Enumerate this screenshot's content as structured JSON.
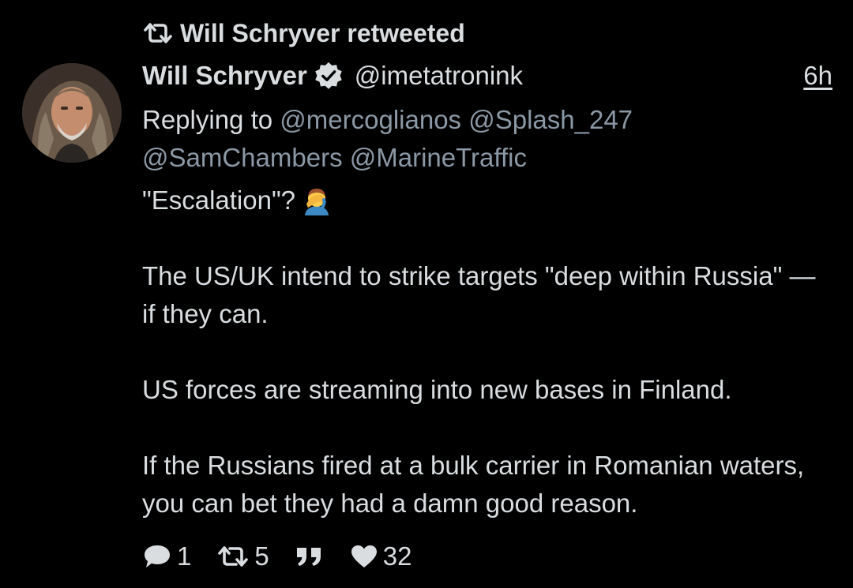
{
  "retweet_banner": {
    "icon": "retweet-icon",
    "text": "Will Schryver retweeted"
  },
  "author": {
    "display_name": "Will Schryver",
    "verified_icon": "verified-badge-icon",
    "handle": "@imetatronink",
    "avatar": "profile-avatar"
  },
  "time": "6h",
  "replying": {
    "prefix": "Replying to",
    "mentions": [
      "@mercoglianos",
      "@Splash_247",
      "@SamChambers",
      "@MarineTraffic"
    ]
  },
  "body": {
    "p1": "\"Escalation\"?",
    "p1_emoji": "facepalm-emoji",
    "p2": "The US/UK intend to strike targets \"deep within Russia\" — if they can.",
    "p3": "US forces are streaming into new bases in Finland.",
    "p4": "If the Russians fired at a bulk carrier in Romanian waters, you can bet they had a damn good reason."
  },
  "actions": {
    "replies": {
      "icon": "reply-icon",
      "count": "1"
    },
    "retweets": {
      "icon": "retweet-icon",
      "count": "5"
    },
    "quote": {
      "icon": "quote-icon"
    },
    "likes": {
      "icon": "heart-icon",
      "count": "32"
    }
  },
  "colors": {
    "background": "#000000",
    "text": "#d9dde0",
    "mention": "#8b98a5"
  }
}
